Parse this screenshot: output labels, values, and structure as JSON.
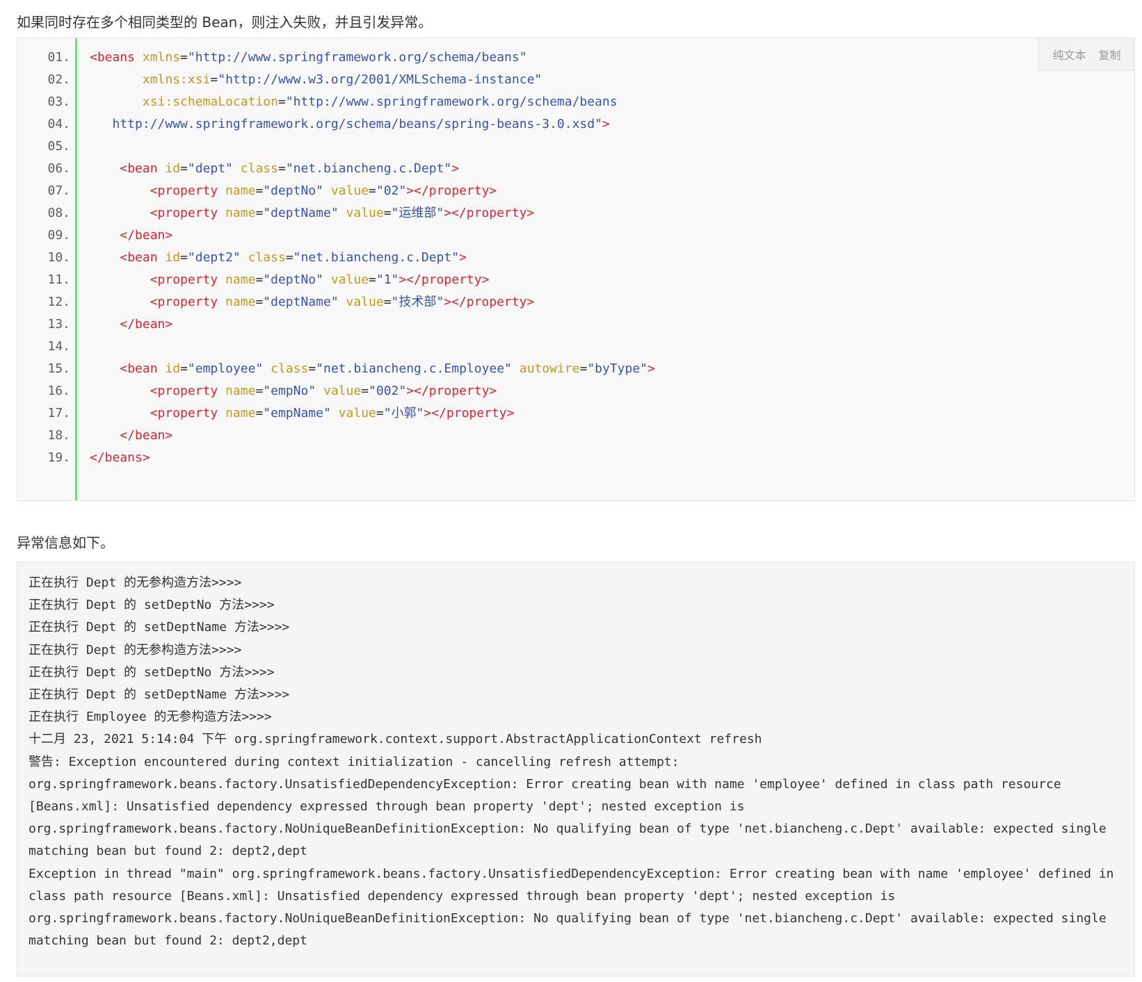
{
  "intro_text": "如果同时存在多个相同类型的 Bean，则注入失败，并且引发异常。",
  "toolbar": {
    "plain_text_label": "纯文本",
    "copy_label": "复制"
  },
  "code_lines": [
    {
      "num": "01.",
      "segments": [
        {
          "t": "tag",
          "s": "<beans "
        },
        {
          "t": "attr",
          "s": "xmlns"
        },
        {
          "t": "eq",
          "s": "="
        },
        {
          "t": "val",
          "s": "\"http://www.springframework.org/schema/beans\""
        }
      ]
    },
    {
      "num": "02.",
      "segments": [
        {
          "t": "eq",
          "s": "       "
        },
        {
          "t": "attr",
          "s": "xmlns:xsi"
        },
        {
          "t": "eq",
          "s": "="
        },
        {
          "t": "val",
          "s": "\"http://www.w3.org/2001/XMLSchema-instance\""
        }
      ]
    },
    {
      "num": "03.",
      "segments": [
        {
          "t": "eq",
          "s": "       "
        },
        {
          "t": "attr",
          "s": "xsi:schemaLocation"
        },
        {
          "t": "eq",
          "s": "="
        },
        {
          "t": "val",
          "s": "\"http://www.springframework.org/schema/beans"
        }
      ]
    },
    {
      "num": "04.",
      "segments": [
        {
          "t": "val",
          "s": "   http://www.springframework.org/schema/beans/spring-beans-3.0.xsd\""
        },
        {
          "t": "tag",
          "s": ">"
        }
      ]
    },
    {
      "num": "05.",
      "segments": []
    },
    {
      "num": "06.",
      "segments": [
        {
          "t": "eq",
          "s": "    "
        },
        {
          "t": "tag",
          "s": "<bean "
        },
        {
          "t": "attr",
          "s": "id"
        },
        {
          "t": "eq",
          "s": "="
        },
        {
          "t": "val",
          "s": "\"dept\""
        },
        {
          "t": "eq",
          "s": " "
        },
        {
          "t": "attr",
          "s": "class"
        },
        {
          "t": "eq",
          "s": "="
        },
        {
          "t": "val",
          "s": "\"net.biancheng.c.Dept\""
        },
        {
          "t": "tag",
          "s": ">"
        }
      ]
    },
    {
      "num": "07.",
      "segments": [
        {
          "t": "eq",
          "s": "        "
        },
        {
          "t": "tag",
          "s": "<property "
        },
        {
          "t": "attr",
          "s": "name"
        },
        {
          "t": "eq",
          "s": "="
        },
        {
          "t": "val",
          "s": "\"deptNo\""
        },
        {
          "t": "eq",
          "s": " "
        },
        {
          "t": "attr",
          "s": "value"
        },
        {
          "t": "eq",
          "s": "="
        },
        {
          "t": "val",
          "s": "\"02\""
        },
        {
          "t": "tag",
          "s": "></property>"
        }
      ]
    },
    {
      "num": "08.",
      "segments": [
        {
          "t": "eq",
          "s": "        "
        },
        {
          "t": "tag",
          "s": "<property "
        },
        {
          "t": "attr",
          "s": "name"
        },
        {
          "t": "eq",
          "s": "="
        },
        {
          "t": "val",
          "s": "\"deptName\""
        },
        {
          "t": "eq",
          "s": " "
        },
        {
          "t": "attr",
          "s": "value"
        },
        {
          "t": "eq",
          "s": "="
        },
        {
          "t": "val",
          "s": "\"运维部\""
        },
        {
          "t": "tag",
          "s": "></property>"
        }
      ]
    },
    {
      "num": "09.",
      "segments": [
        {
          "t": "eq",
          "s": "    "
        },
        {
          "t": "tag",
          "s": "</bean>"
        }
      ]
    },
    {
      "num": "10.",
      "segments": [
        {
          "t": "eq",
          "s": "    "
        },
        {
          "t": "tag",
          "s": "<bean "
        },
        {
          "t": "attr",
          "s": "id"
        },
        {
          "t": "eq",
          "s": "="
        },
        {
          "t": "val",
          "s": "\"dept2\""
        },
        {
          "t": "eq",
          "s": " "
        },
        {
          "t": "attr",
          "s": "class"
        },
        {
          "t": "eq",
          "s": "="
        },
        {
          "t": "val",
          "s": "\"net.biancheng.c.Dept\""
        },
        {
          "t": "tag",
          "s": ">"
        }
      ]
    },
    {
      "num": "11.",
      "segments": [
        {
          "t": "eq",
          "s": "        "
        },
        {
          "t": "tag",
          "s": "<property "
        },
        {
          "t": "attr",
          "s": "name"
        },
        {
          "t": "eq",
          "s": "="
        },
        {
          "t": "val",
          "s": "\"deptNo\""
        },
        {
          "t": "eq",
          "s": " "
        },
        {
          "t": "attr",
          "s": "value"
        },
        {
          "t": "eq",
          "s": "="
        },
        {
          "t": "val",
          "s": "\"1\""
        },
        {
          "t": "tag",
          "s": "></property>"
        }
      ]
    },
    {
      "num": "12.",
      "segments": [
        {
          "t": "eq",
          "s": "        "
        },
        {
          "t": "tag",
          "s": "<property "
        },
        {
          "t": "attr",
          "s": "name"
        },
        {
          "t": "eq",
          "s": "="
        },
        {
          "t": "val",
          "s": "\"deptName\""
        },
        {
          "t": "eq",
          "s": " "
        },
        {
          "t": "attr",
          "s": "value"
        },
        {
          "t": "eq",
          "s": "="
        },
        {
          "t": "val",
          "s": "\"技术部\""
        },
        {
          "t": "tag",
          "s": "></property>"
        }
      ]
    },
    {
      "num": "13.",
      "segments": [
        {
          "t": "eq",
          "s": "    "
        },
        {
          "t": "tag",
          "s": "</bean>"
        }
      ]
    },
    {
      "num": "14.",
      "segments": []
    },
    {
      "num": "15.",
      "segments": [
        {
          "t": "eq",
          "s": "    "
        },
        {
          "t": "tag",
          "s": "<bean "
        },
        {
          "t": "attr",
          "s": "id"
        },
        {
          "t": "eq",
          "s": "="
        },
        {
          "t": "val",
          "s": "\"employee\""
        },
        {
          "t": "eq",
          "s": " "
        },
        {
          "t": "attr",
          "s": "class"
        },
        {
          "t": "eq",
          "s": "="
        },
        {
          "t": "val",
          "s": "\"net.biancheng.c.Employee\""
        },
        {
          "t": "eq",
          "s": " "
        },
        {
          "t": "attr",
          "s": "autowire"
        },
        {
          "t": "eq",
          "s": "="
        },
        {
          "t": "val",
          "s": "\"byType\""
        },
        {
          "t": "tag",
          "s": ">"
        }
      ]
    },
    {
      "num": "16.",
      "segments": [
        {
          "t": "eq",
          "s": "        "
        },
        {
          "t": "tag",
          "s": "<property "
        },
        {
          "t": "attr",
          "s": "name"
        },
        {
          "t": "eq",
          "s": "="
        },
        {
          "t": "val",
          "s": "\"empNo\""
        },
        {
          "t": "eq",
          "s": " "
        },
        {
          "t": "attr",
          "s": "value"
        },
        {
          "t": "eq",
          "s": "="
        },
        {
          "t": "val",
          "s": "\"002\""
        },
        {
          "t": "tag",
          "s": "></property>"
        }
      ]
    },
    {
      "num": "17.",
      "segments": [
        {
          "t": "eq",
          "s": "        "
        },
        {
          "t": "tag",
          "s": "<property "
        },
        {
          "t": "attr",
          "s": "name"
        },
        {
          "t": "eq",
          "s": "="
        },
        {
          "t": "val",
          "s": "\"empName\""
        },
        {
          "t": "eq",
          "s": " "
        },
        {
          "t": "attr",
          "s": "value"
        },
        {
          "t": "eq",
          "s": "="
        },
        {
          "t": "val",
          "s": "\"小郭\""
        },
        {
          "t": "tag",
          "s": "></property>"
        }
      ]
    },
    {
      "num": "18.",
      "segments": [
        {
          "t": "eq",
          "s": "    "
        },
        {
          "t": "tag",
          "s": "</bean>"
        }
      ]
    },
    {
      "num": "19.",
      "segments": [
        {
          "t": "tag",
          "s": "</beans>"
        }
      ]
    }
  ],
  "exception_heading": "异常信息如下。",
  "console_lines": [
    "正在执行 Dept 的无参构造方法>>>>",
    "正在执行 Dept 的 setDeptNo 方法>>>>",
    "正在执行 Dept 的 setDeptName 方法>>>>",
    "正在执行 Dept 的无参构造方法>>>>",
    "正在执行 Dept 的 setDeptNo 方法>>>>",
    "正在执行 Dept 的 setDeptName 方法>>>>",
    "正在执行 Employee 的无参构造方法>>>>",
    "十二月 23, 2021 5:14:04 下午 org.springframework.context.support.AbstractApplicationContext refresh",
    "警告: Exception encountered during context initialization - cancelling refresh attempt:",
    "org.springframework.beans.factory.UnsatisfiedDependencyException: Error creating bean with name 'employee' defined in class path resource",
    "[Beans.xml]: Unsatisfied dependency expressed through bean property 'dept'; nested exception is",
    "org.springframework.beans.factory.NoUniqueBeanDefinitionException: No qualifying bean of type 'net.biancheng.c.Dept' available: expected single",
    "matching bean but found 2: dept2,dept",
    "Exception in thread \"main\" org.springframework.beans.factory.UnsatisfiedDependencyException: Error creating bean with name 'employee' defined in",
    "class path resource [Beans.xml]: Unsatisfied dependency expressed through bean property 'dept'; nested exception is",
    "org.springframework.beans.factory.NoUniqueBeanDefinitionException: No qualifying bean of type 'net.biancheng.c.Dept' available: expected single",
    "matching bean but found 2: dept2,dept"
  ]
}
